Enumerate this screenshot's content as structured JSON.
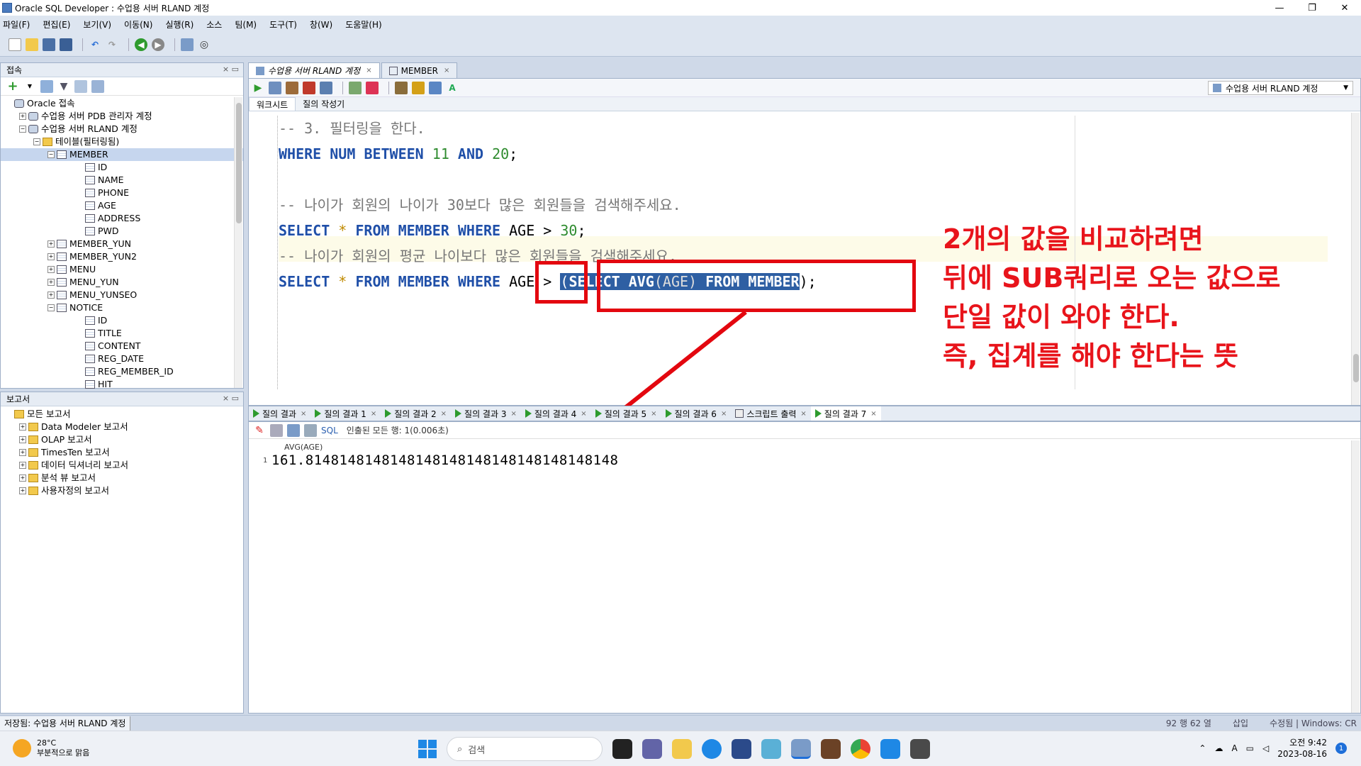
{
  "window": {
    "title": "Oracle SQL Developer : 수업용 서버 RLAND 계정",
    "minimize": "—",
    "restore": "❐",
    "close": "✕"
  },
  "menu": [
    "파일(F)",
    "편집(E)",
    "보기(V)",
    "이동(N)",
    "실행(R)",
    "소스",
    "팀(M)",
    "도구(T)",
    "창(W)",
    "도움말(H)"
  ],
  "connections_panel": {
    "title": "접속",
    "tree": [
      {
        "label": "Oracle 접속",
        "indent": 0,
        "icon": "db",
        "exp": ""
      },
      {
        "label": "수업용 서버 PDB 관리자 계정",
        "indent": 1,
        "icon": "db",
        "exp": "+"
      },
      {
        "label": "수업용 서버 RLAND 계정",
        "indent": 1,
        "icon": "db",
        "exp": "−"
      },
      {
        "label": "테이블(필터링됨)",
        "indent": 2,
        "icon": "folder",
        "exp": "−"
      },
      {
        "label": "MEMBER",
        "indent": 3,
        "icon": "table",
        "exp": "−",
        "selected": true
      },
      {
        "label": "ID",
        "indent": 5,
        "icon": "col",
        "exp": ""
      },
      {
        "label": "NAME",
        "indent": 5,
        "icon": "col",
        "exp": ""
      },
      {
        "label": "PHONE",
        "indent": 5,
        "icon": "col",
        "exp": ""
      },
      {
        "label": "AGE",
        "indent": 5,
        "icon": "col",
        "exp": ""
      },
      {
        "label": "ADDRESS",
        "indent": 5,
        "icon": "col",
        "exp": ""
      },
      {
        "label": "PWD",
        "indent": 5,
        "icon": "col",
        "exp": ""
      },
      {
        "label": "MEMBER_YUN",
        "indent": 3,
        "icon": "table",
        "exp": "+"
      },
      {
        "label": "MEMBER_YUN2",
        "indent": 3,
        "icon": "table",
        "exp": "+"
      },
      {
        "label": "MENU",
        "indent": 3,
        "icon": "table",
        "exp": "+"
      },
      {
        "label": "MENU_YUN",
        "indent": 3,
        "icon": "table",
        "exp": "+"
      },
      {
        "label": "MENU_YUNSEO",
        "indent": 3,
        "icon": "table",
        "exp": "+"
      },
      {
        "label": "NOTICE",
        "indent": 3,
        "icon": "table",
        "exp": "−"
      },
      {
        "label": "ID",
        "indent": 5,
        "icon": "col",
        "exp": ""
      },
      {
        "label": "TITLE",
        "indent": 5,
        "icon": "col",
        "exp": ""
      },
      {
        "label": "CONTENT",
        "indent": 5,
        "icon": "col",
        "exp": ""
      },
      {
        "label": "REG_DATE",
        "indent": 5,
        "icon": "col",
        "exp": ""
      },
      {
        "label": "REG_MEMBER_ID",
        "indent": 5,
        "icon": "col",
        "exp": ""
      },
      {
        "label": "HIT",
        "indent": 5,
        "icon": "col",
        "exp": ""
      }
    ]
  },
  "reports_panel": {
    "title": "보고서",
    "tree": [
      {
        "label": "모든 보고서",
        "indent": 0,
        "icon": "folder",
        "exp": ""
      },
      {
        "label": "Data Modeler 보고서",
        "indent": 1,
        "icon": "folder",
        "exp": "+"
      },
      {
        "label": "OLAP 보고서",
        "indent": 1,
        "icon": "folder",
        "exp": "+"
      },
      {
        "label": "TimesTen 보고서",
        "indent": 1,
        "icon": "folder",
        "exp": "+"
      },
      {
        "label": "데이터 딕셔너리 보고서",
        "indent": 1,
        "icon": "folder",
        "exp": "+"
      },
      {
        "label": "분석 뷰 보고서",
        "indent": 1,
        "icon": "folder",
        "exp": "+"
      },
      {
        "label": "사용자정의 보고서",
        "indent": 1,
        "icon": "folder",
        "exp": "+"
      }
    ]
  },
  "editor_tabs": [
    {
      "label": "수업용 서버 RLAND 계정",
      "active": true
    },
    {
      "label": "MEMBER",
      "active": false
    }
  ],
  "connection_selector": "수업용 서버 RLAND 계정",
  "sub_tabs": [
    "워크시트",
    "질의 작성기"
  ],
  "code_lines": {
    "l1": "-- 3. 필터링을 한다.",
    "l2a": "WHERE",
    "l2b": " NUM ",
    "l2c": "BETWEEN",
    "l2d": " 11 ",
    "l2e": "AND",
    "l2f": " 20",
    "l2g": ";",
    "l4": "-- 나이가 회원의 나이가 30보다 많은 회원들을 검색해주세요.",
    "l5a": "SELECT",
    "l5b": " * ",
    "l5c": "FROM",
    "l5d": " MEMBER ",
    "l5e": "WHERE",
    "l5f": " AGE > ",
    "l5g": "30",
    "l5h": ";",
    "l6": "-- 나이가 회원의 평균 나이보다 많은 회원들을 검색해주세요.",
    "l7a": "SELECT",
    "l7b": " * ",
    "l7c": "FROM",
    "l7d": " MEMBER ",
    "l7e": "WHERE",
    "l7f": " AGE > ",
    "l7g": "(",
    "l7h": "SELECT",
    "l7i": " AVG",
    "l7j": "(AGE)",
    "l7k": " FROM",
    "l7l": " MEMBER",
    "l7m": ")",
    "l7n": ";"
  },
  "annotation": [
    "2개의 값을 비교하려면",
    "뒤에 SUB쿼리로 오는 값으로",
    "단일 값이 와야 한다.",
    "즉, 집계를 해야 한다는 뜻"
  ],
  "result_tabs": [
    "질의 결과",
    "질의 결과 1",
    "질의 결과 2",
    "질의 결과 3",
    "질의 결과 4",
    "질의 결과 5",
    "질의 결과 6",
    "스크립트 출력",
    "질의 결과 7"
  ],
  "result_toolbar": {
    "sql_label": "SQL",
    "status": "인출된 모든 행: 1(0.006초)"
  },
  "result_grid": {
    "column": "AVG(AGE)",
    "row_number": "1",
    "value": "161.8148148148148148148148148148148148148"
  },
  "status": {
    "left": "저장됨: 수업용 서버 RLAND 계정",
    "position": "92 행 62 열",
    "mode": "삽입",
    "modified": "수정됨 | Windows: CR"
  },
  "taskbar": {
    "temp": "28°C",
    "weather": "부분적으로 맑음",
    "search": "검색",
    "time": "오전 9:42",
    "date": "2023-08-16",
    "notif": "1"
  }
}
